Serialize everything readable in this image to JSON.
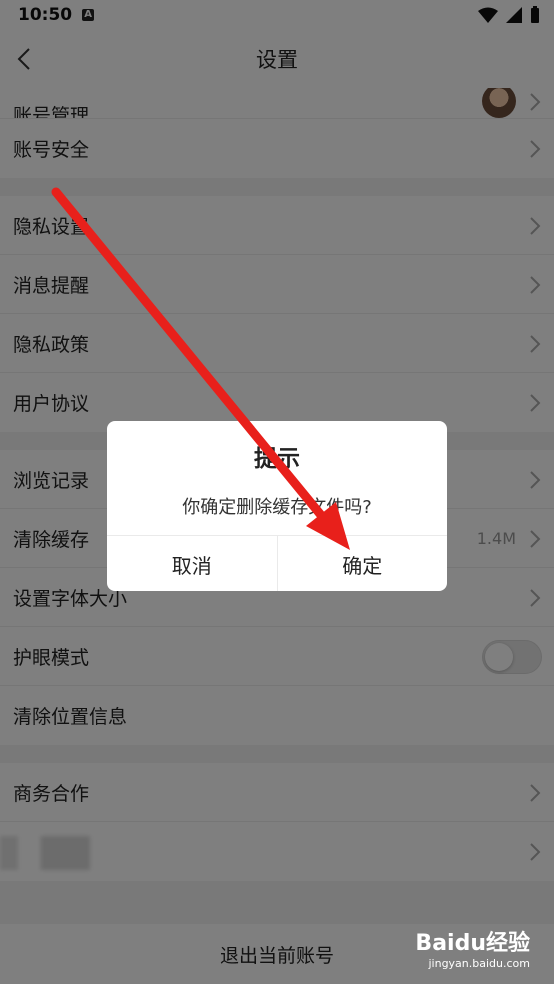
{
  "status": {
    "time": "10:50",
    "badge": "A"
  },
  "nav": {
    "title": "设置"
  },
  "groups": {
    "g1": [
      {
        "label": "账号管理"
      },
      {
        "label": "账号安全"
      }
    ],
    "g2": [
      {
        "label": "隐私设置"
      },
      {
        "label": "消息提醒"
      },
      {
        "label": "隐私政策"
      },
      {
        "label": "用户协议"
      }
    ],
    "g3": [
      {
        "label": "浏览记录"
      },
      {
        "label": "清除缓存",
        "value": "1.4M"
      },
      {
        "label": "设置字体大小"
      },
      {
        "label": "护眼模式"
      },
      {
        "label": "清除位置信息"
      }
    ],
    "g4": [
      {
        "label": "商务合作"
      }
    ]
  },
  "logout": {
    "label": "退出当前账号"
  },
  "dialog": {
    "title": "提示",
    "message": "你确定删除缓存文件吗?",
    "cancel": "取消",
    "confirm": "确定"
  },
  "watermark": {
    "brand": "Baidu经验",
    "url": "jingyan.baidu.com"
  },
  "colors": {
    "arrow": "#e8201b",
    "overlay": "rgba(0,0,0,0.5)"
  }
}
